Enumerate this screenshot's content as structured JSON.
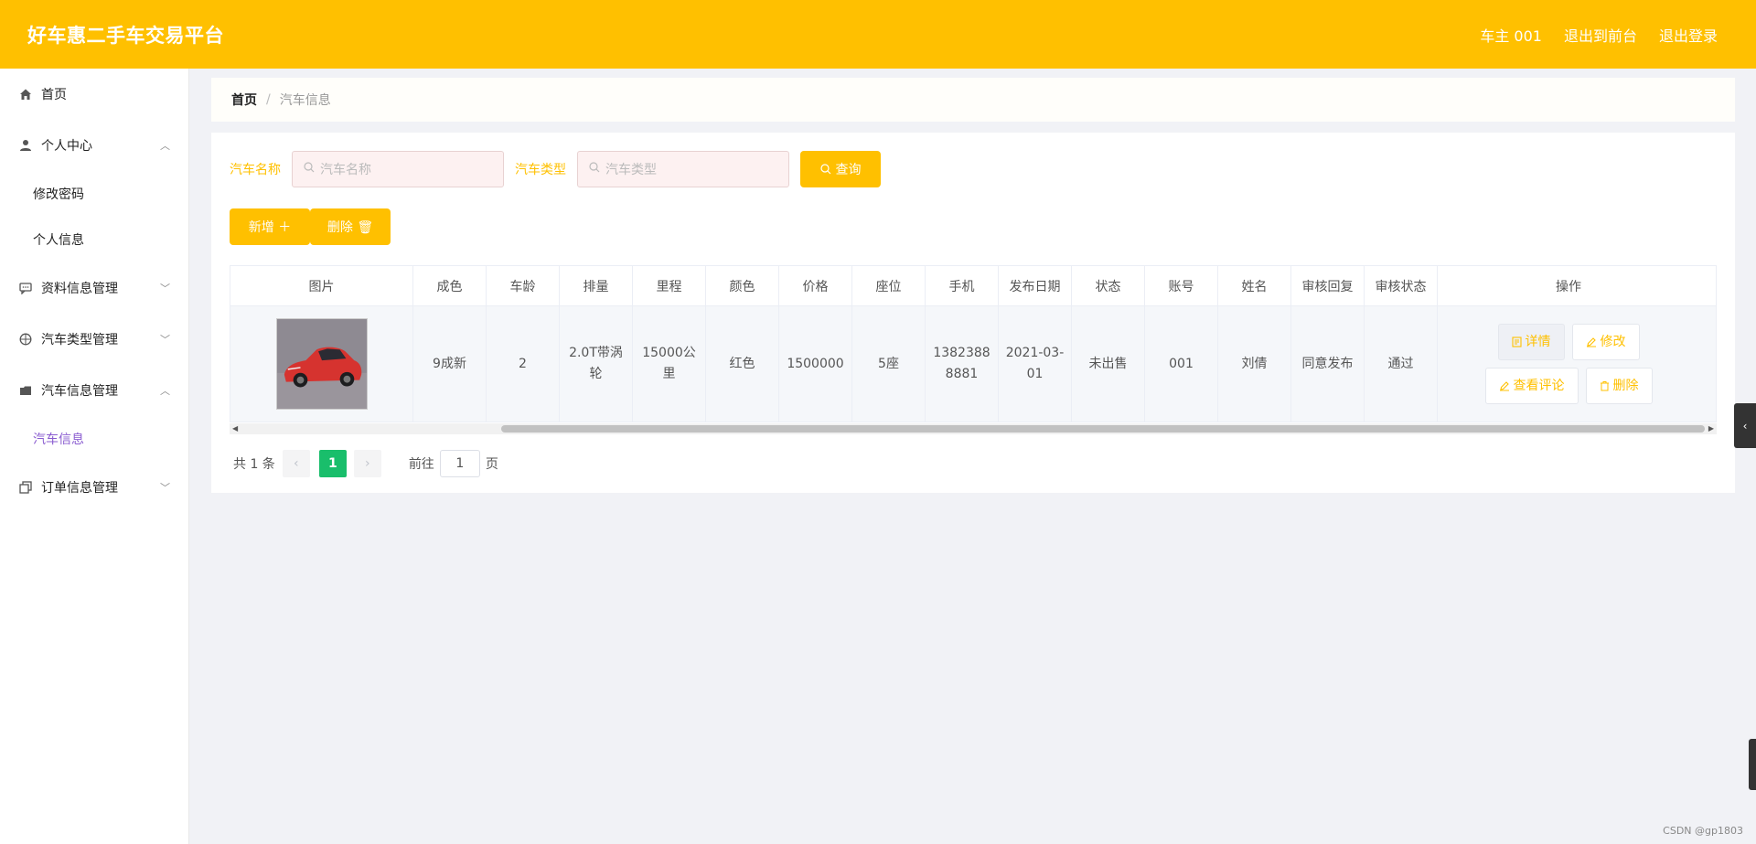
{
  "header": {
    "brand": "好车惠二手车交易平台",
    "user": "车主 001",
    "to_front": "退出到前台",
    "logout": "退出登录"
  },
  "sidebar": {
    "items": [
      {
        "label": "首页",
        "icon": "home-icon"
      },
      {
        "label": "个人中心",
        "icon": "user-icon",
        "expanded": true,
        "children": [
          "修改密码",
          "个人信息"
        ]
      },
      {
        "label": "资料信息管理",
        "icon": "chat-icon"
      },
      {
        "label": "汽车类型管理",
        "icon": "compass-icon"
      },
      {
        "label": "汽车信息管理",
        "icon": "folder-icon",
        "expanded": true,
        "children": [
          "汽车信息"
        ]
      },
      {
        "label": "订单信息管理",
        "icon": "copy-icon"
      }
    ]
  },
  "breadcrumb": {
    "home": "首页",
    "sep": "/",
    "current": "汽车信息"
  },
  "search": {
    "name_label": "汽车名称",
    "name_placeholder": "汽车名称",
    "type_label": "汽车类型",
    "type_placeholder": "汽车类型",
    "query_btn": "查询"
  },
  "actions": {
    "add": "新增 ＋",
    "delete": "删除 🗑"
  },
  "table": {
    "headers": [
      "图片",
      "成色",
      "车龄",
      "排量",
      "里程",
      "颜色",
      "价格",
      "座位",
      "手机",
      "发布日期",
      "状态",
      "账号",
      "姓名",
      "审核回复",
      "审核状态",
      "操作"
    ],
    "rows": [
      {
        "image": "red-car-photo",
        "condition": "9成新",
        "age": "2",
        "displacement": "2.0T带涡轮",
        "mileage": "15000公里",
        "color": "红色",
        "price": "1500000",
        "seats": "5座",
        "phone": "13823888881",
        "date": "2021-03-01",
        "status": "未出售",
        "account": "001",
        "name": "刘倩",
        "reply": "同意发布",
        "audit": "通过"
      }
    ],
    "ops": {
      "detail": "详情",
      "edit": "修改",
      "review": "查看评论",
      "delete": "删除"
    }
  },
  "pager": {
    "total": "共 1 条",
    "current_page": "1",
    "goto_label": "前往",
    "goto_value": "1",
    "page_suffix": "页"
  },
  "watermark": "CSDN @gp1803",
  "colors": {
    "accent": "#ffc000",
    "active_page": "#19be6b",
    "active_menu": "#8a5cd0"
  }
}
